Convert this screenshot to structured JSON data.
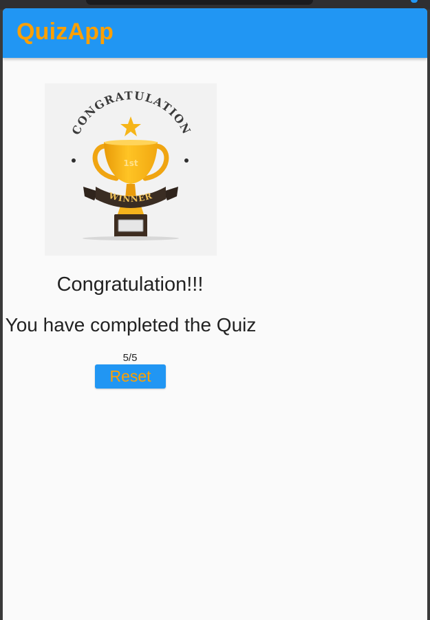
{
  "app_bar": {
    "title": "QuizApp"
  },
  "result": {
    "image": {
      "top_arc_text": "CONGRATULATION",
      "ribbon_text": "WINNER",
      "cup_text": "1st"
    },
    "headline": "Congratulation!!!",
    "message": "You have completed the Quiz",
    "score": "5/5",
    "reset_label": "Reset"
  },
  "colors": {
    "app_bar": "#2196f3",
    "title_text": "#ffa000",
    "button_bg": "#2196f3",
    "button_text": "#ffa000",
    "background": "#fafafa"
  }
}
